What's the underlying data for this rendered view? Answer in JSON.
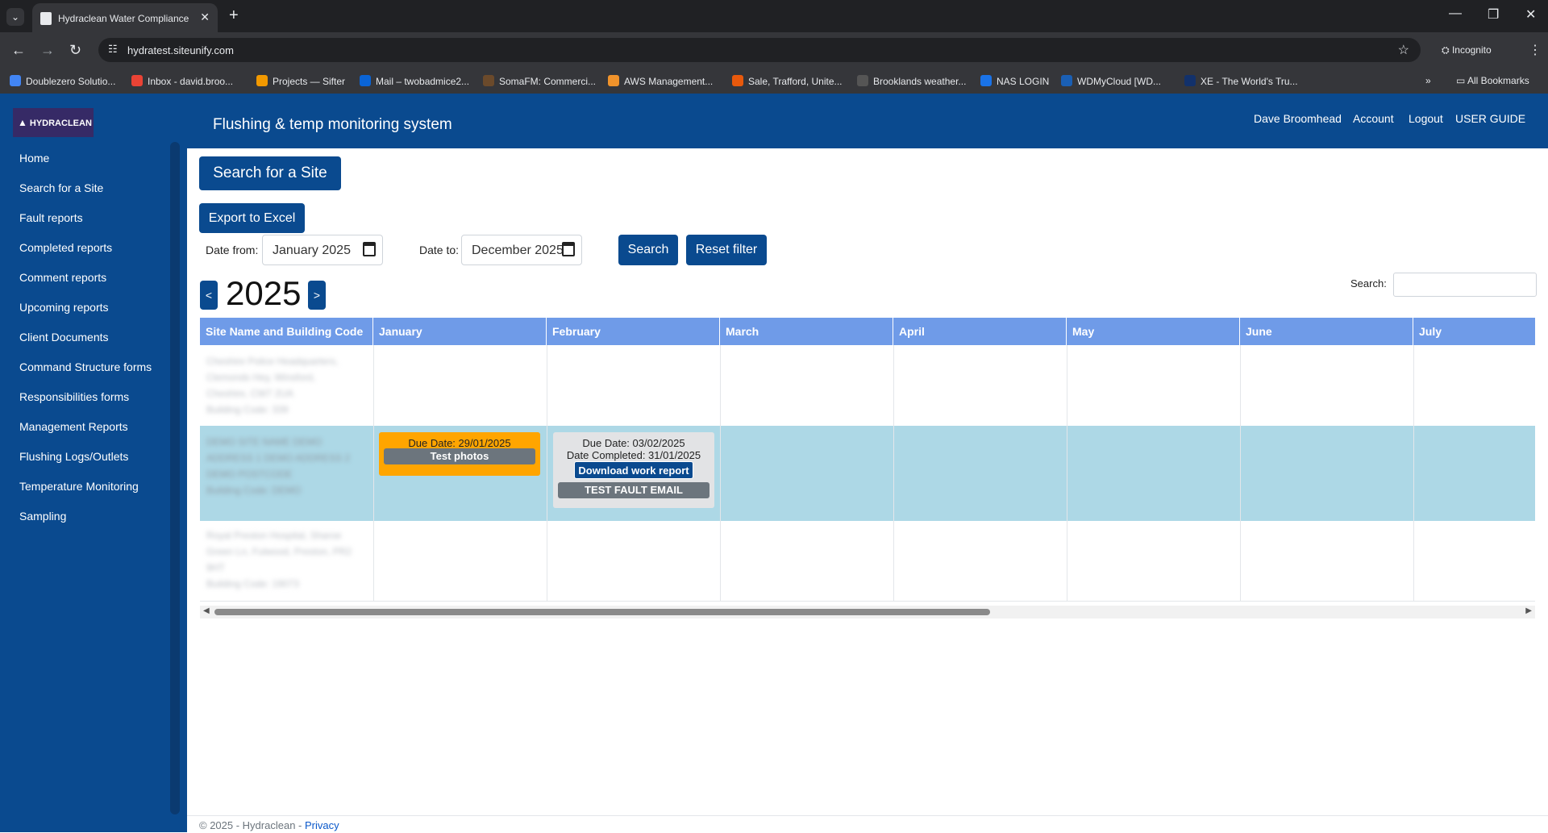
{
  "browser": {
    "tab_title": "Hydraclean Water Compliance",
    "url": "hydratest.siteunify.com",
    "incognito_label": "Incognito",
    "bookmarks": [
      {
        "label": "Doublezero Solutio...",
        "color": "#4285f4"
      },
      {
        "label": "Inbox - david.broo...",
        "color": "#ea4335"
      },
      {
        "label": "Projects — Sifter",
        "color": "#f29900"
      },
      {
        "label": "Mail – twobadmice2...",
        "color": "#0a64d6"
      },
      {
        "label": "SomaFM: Commerci...",
        "color": "#6b4a2b"
      },
      {
        "label": "AWS Management...",
        "color": "#f0932b"
      },
      {
        "label": "Sale, Trafford, Unite...",
        "color": "#e8590c"
      },
      {
        "label": "Brooklands weather...",
        "color": "#555555"
      },
      {
        "label": "NAS LOGIN",
        "color": "#1a73e8"
      },
      {
        "label": "WDMyCloud [WD...",
        "color": "#1a5fb4"
      },
      {
        "label": "XE - The World's Tru...",
        "color": "#12316b"
      }
    ],
    "all_bookmarks": "All Bookmarks"
  },
  "app": {
    "logo_text": "HYDRACLEAN",
    "title": "Flushing & temp monitoring system",
    "header_links": [
      "Dave Broomhead",
      "Account",
      "Logout",
      "USER GUIDE"
    ],
    "sidebar": [
      "Home",
      "Search for a Site",
      "Fault reports",
      "Completed reports",
      "Comment reports",
      "Upcoming reports",
      "Client Documents",
      "Command Structure forms",
      "Responsibilities forms",
      "Management Reports",
      "Flushing Logs/Outlets",
      "Temperature Monitoring",
      "Sampling"
    ]
  },
  "controls": {
    "search_site": "Search for a Site",
    "export": "Export to Excel",
    "date_from_label": "Date from:",
    "date_from_value": "January 2025",
    "date_to_label": "Date to:",
    "date_to_value": "December 2025",
    "search_btn": "Search",
    "reset_btn": "Reset filter",
    "year": "2025",
    "prev": "<",
    "next": ">",
    "search_label": "Search:"
  },
  "table": {
    "headers": [
      "Site Name and Building Code",
      "January",
      "February",
      "March",
      "April",
      "May",
      "June",
      "July"
    ],
    "rows": [
      {
        "site_lines": [
          "Cheshire Police Headquarters,",
          "Clemonds Hey, Winsford,",
          "Cheshire, CW7 2UA",
          "Building Code: 339"
        ]
      },
      {
        "site_lines": [
          "DEMO SITE NAME DEMO",
          "ADDRESS 1 DEMO ADDRESS 2",
          "DEMO POSTCODE",
          "Building Code: DEMO"
        ]
      },
      {
        "site_lines": [
          "Royal Preston Hospital, Sharoe",
          "Green Ln, Fulwood, Preston, PR2",
          "9HT",
          "Building Code: 19073"
        ]
      }
    ],
    "jan_card": {
      "due": "Due Date: 29/01/2025",
      "action": "Test photos",
      "color": "#ffa500"
    },
    "feb_card": {
      "due": "Due Date: 03/02/2025",
      "completed": "Date Completed: 31/01/2025",
      "download": "Download work report",
      "fault": "TEST FAULT EMAIL"
    }
  },
  "footer": {
    "copyright": "© 2025 - Hydraclean - ",
    "privacy": "Privacy"
  }
}
